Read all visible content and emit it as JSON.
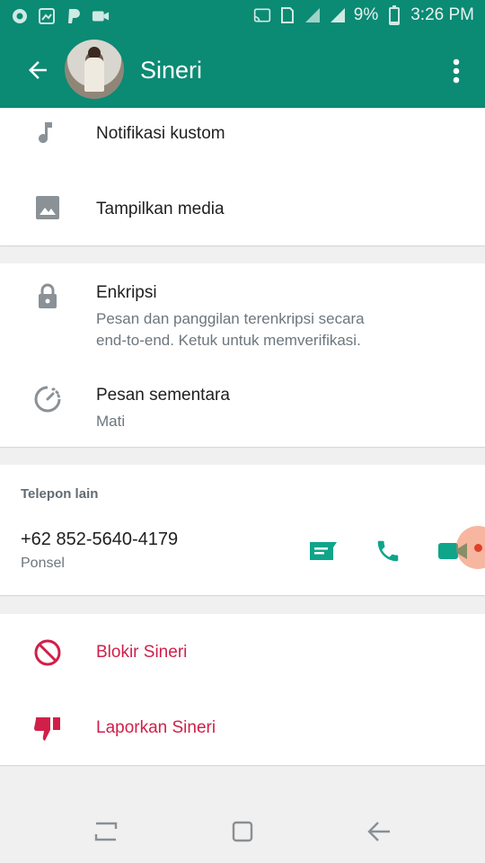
{
  "status_bar": {
    "battery": "9%",
    "time": "3:26 PM",
    "icons": [
      "chrome-icon",
      "gallery-icon",
      "paypal-icon",
      "video-icon",
      "cast-icon",
      "sim-icon",
      "signal-icon",
      "signal-icon",
      "battery-icon"
    ]
  },
  "app_bar": {
    "title": "Sineri",
    "back_icon": "arrow-back-icon",
    "menu_icon": "more-vert-icon"
  },
  "media_section": {
    "items": [
      {
        "icon": "music-note-icon",
        "label": "Notifikasi kustom"
      },
      {
        "icon": "image-icon",
        "label": "Tampilkan media"
      }
    ]
  },
  "privacy_section": {
    "encryption": {
      "icon": "lock-icon",
      "label": "Enkripsi",
      "description_line1": "Pesan dan panggilan terenkripsi secara",
      "description_line2": "end-to-end. Ketuk untuk memverifikasi."
    },
    "disappearing": {
      "icon": "timer-icon",
      "label": "Pesan sementara",
      "value": "Mati"
    }
  },
  "phone_section": {
    "header": "Telepon lain",
    "number": "+62 852-5640-4179",
    "type": "Ponsel",
    "actions": [
      "message-icon",
      "phone-icon",
      "video-call-icon"
    ]
  },
  "danger_section": {
    "block": {
      "icon": "block-icon",
      "label": "Blokir Sineri"
    },
    "report": {
      "icon": "thumb-down-icon",
      "label": "Laporkan Sineri"
    }
  },
  "colors": {
    "primary": "#0b8a74",
    "accent": "#0ea58a",
    "danger": "#d0204a",
    "touch_indicator": "#f07a50"
  }
}
